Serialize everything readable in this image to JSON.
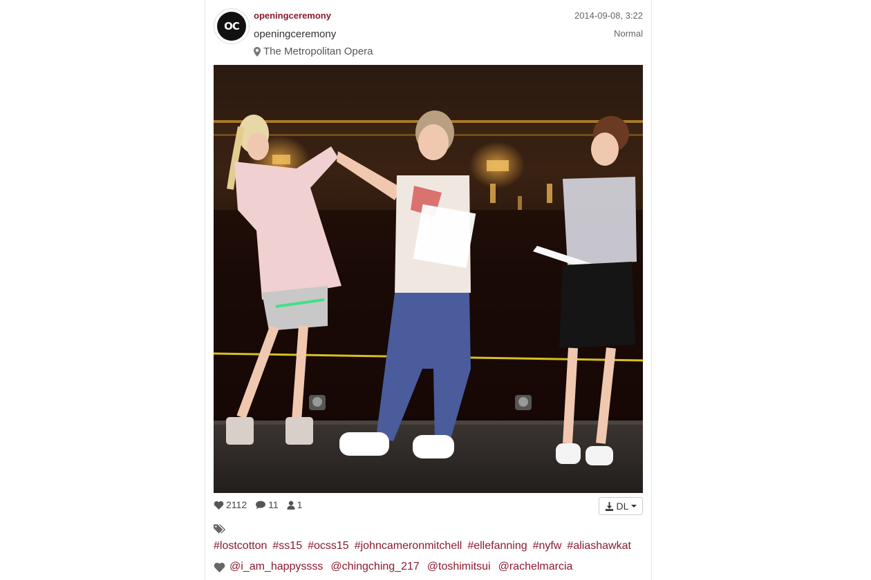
{
  "post": {
    "username": "openingceremony",
    "avatar_text": "OC",
    "full_name": "openingceremony",
    "location": "The Metropolitan Opera",
    "timestamp": "2014-09-08, 3:22",
    "filter": "Normal"
  },
  "stats": {
    "likes": "2112",
    "comments": "11",
    "users": "1"
  },
  "download": {
    "label": "DL"
  },
  "tags": [
    "#lostcotton",
    "#ss15",
    "#ocss15",
    "#johncameronmitchell",
    "#ellefanning",
    "#nyfw",
    "#aliashawkat"
  ],
  "mentions": [
    "@i_am_happyssss",
    "@chingching_217",
    "@toshimitsui",
    "@rachelmarcia"
  ],
  "colors": {
    "accent": "#8b1a2f",
    "stage_floor": "#2b2624",
    "backdrop": "#1a0d07"
  },
  "icons": {
    "location": "map-marker-icon",
    "likes": "heart-icon",
    "comments": "comment-icon",
    "users": "user-icon",
    "download": "download-icon",
    "dropdown": "caret-down-icon",
    "tags": "tags-icon",
    "mentions": "heart-icon"
  }
}
